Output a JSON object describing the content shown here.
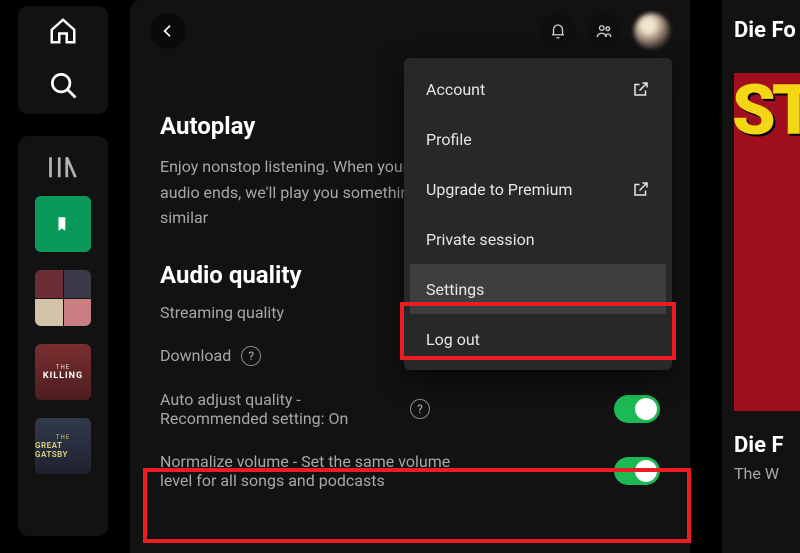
{
  "section_autoplay": {
    "title": "Autoplay",
    "description": "Enjoy nonstop listening. When your audio ends, we'll play you something similar"
  },
  "section_audio": {
    "title": "Audio quality",
    "streaming_label": "Streaming quality",
    "download_label": "Download",
    "auto_adjust_label": "Auto adjust quality - Recommended setting: On",
    "normalize_label": "Normalize volume - Set the same volume level for all songs and podcasts"
  },
  "menu": {
    "account": "Account",
    "profile": "Profile",
    "upgrade": "Upgrade to Premium",
    "private": "Private session",
    "settings": "Settings",
    "logout": "Log out"
  },
  "right": {
    "section_title": "Die Fo",
    "cover_text": "ST",
    "track_title": "Die F",
    "artist": "The W"
  },
  "library_arts": {
    "killing_top": "THE",
    "killing_main": "KILLING",
    "gatsby_top": "THE",
    "gatsby_main": "GREAT GATSBY"
  }
}
